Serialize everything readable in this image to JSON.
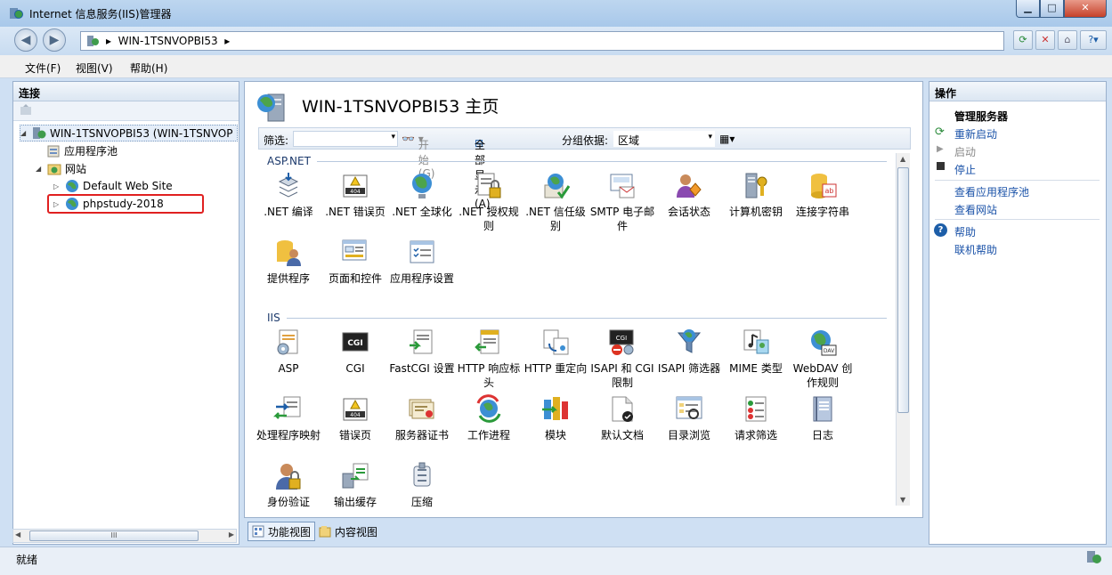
{
  "window": {
    "title": "Internet 信息服务(IIS)管理器"
  },
  "nav": {
    "address": "WIN-1TSNVOPBI53"
  },
  "menu": [
    "文件(F)",
    "视图(V)",
    "帮助(H)"
  ],
  "connections": {
    "header": "连接",
    "tree": [
      {
        "label": "WIN-1TSNVOPBI53 (WIN-1TSNVOP",
        "level": 0
      },
      {
        "label": "应用程序池",
        "level": 1
      },
      {
        "label": "网站",
        "level": 1
      },
      {
        "label": "Default Web Site",
        "level": 2
      },
      {
        "label": "phpstudy-2018",
        "level": 2
      }
    ],
    "hscroll_glyph": "III"
  },
  "center": {
    "title": "WIN-1TSNVOPBI53 主页",
    "filter": {
      "label": "筛选:",
      "start": "开始(G)",
      "showall": "全部显示(A)",
      "groupby_label": "分组依据:",
      "groupby_value": "区域"
    },
    "groups": [
      {
        "name": "ASP.NET",
        "items": [
          {
            "label": ".NET 编译",
            "icon": "compile-icon"
          },
          {
            "label": ".NET 错误页",
            "icon": "error-page-icon"
          },
          {
            "label": ".NET 全球化",
            "icon": "globe-icon"
          },
          {
            "label": ".NET 授权规则",
            "icon": "lock-doc-icon"
          },
          {
            "label": ".NET 信任级别",
            "icon": "trust-icon"
          },
          {
            "label": "SMTP 电子邮件",
            "icon": "mail-icon"
          },
          {
            "label": "会话状态",
            "icon": "session-icon"
          },
          {
            "label": "计算机密钥",
            "icon": "key-icon"
          },
          {
            "label": "连接字符串",
            "icon": "db-icon"
          },
          {
            "label": "提供程序",
            "icon": "provider-icon"
          },
          {
            "label": "页面和控件",
            "icon": "pages-icon"
          },
          {
            "label": "应用程序设置",
            "icon": "appsettings-icon"
          }
        ]
      },
      {
        "name": "IIS",
        "items": [
          {
            "label": "ASP",
            "icon": "asp-icon"
          },
          {
            "label": "CGI",
            "icon": "cgi-icon"
          },
          {
            "label": "FastCGI 设置",
            "icon": "fastcgi-icon"
          },
          {
            "label": "HTTP 响应标头",
            "icon": "http-header-icon"
          },
          {
            "label": "HTTP 重定向",
            "icon": "redirect-icon"
          },
          {
            "label": "ISAPI 和 CGI 限制",
            "icon": "isapi-cgi-icon"
          },
          {
            "label": "ISAPI 筛选器",
            "icon": "isapi-filter-icon"
          },
          {
            "label": "MIME 类型",
            "icon": "mime-icon"
          },
          {
            "label": "WebDAV 创作规则",
            "icon": "webdav-icon"
          },
          {
            "label": "处理程序映射",
            "icon": "handler-icon"
          },
          {
            "label": "错误页",
            "icon": "error-page-icon"
          },
          {
            "label": "服务器证书",
            "icon": "cert-icon"
          },
          {
            "label": "工作进程",
            "icon": "worker-icon"
          },
          {
            "label": "模块",
            "icon": "modules-icon"
          },
          {
            "label": "默认文档",
            "icon": "default-doc-icon"
          },
          {
            "label": "目录浏览",
            "icon": "dir-browse-icon"
          },
          {
            "label": "请求筛选",
            "icon": "request-filter-icon"
          },
          {
            "label": "日志",
            "icon": "log-icon"
          },
          {
            "label": "身份验证",
            "icon": "auth-icon"
          },
          {
            "label": "输出缓存",
            "icon": "cache-icon"
          },
          {
            "label": "压缩",
            "icon": "compress-icon"
          }
        ]
      }
    ],
    "viewtabs": {
      "features": "功能视图",
      "content": "内容视图"
    }
  },
  "actions": {
    "header": "操作",
    "manage_header": "管理服务器",
    "restart": "重新启动",
    "start": "启动",
    "stop": "停止",
    "view_pools": "查看应用程序池",
    "view_sites": "查看网站",
    "help": "帮助",
    "online_help": "联机帮助"
  },
  "status": {
    "text": "就绪"
  }
}
